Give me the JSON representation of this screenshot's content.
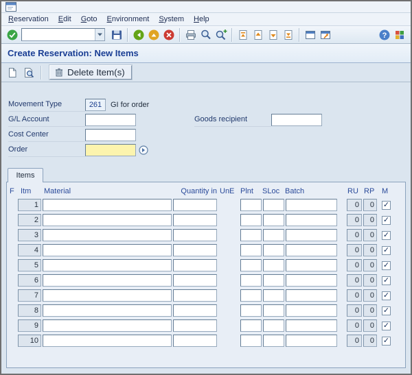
{
  "menu_bar": {
    "items": [
      "Reservation",
      "Edit",
      "Goto",
      "Environment",
      "System",
      "Help"
    ]
  },
  "toolbar": {
    "command_field_value": "",
    "icons": [
      "enter",
      "command-field-dropdown",
      "save",
      "back",
      "exit",
      "cancel",
      "print",
      "find",
      "find-next",
      "first-page",
      "page-up",
      "page-down",
      "last-page",
      "new-session",
      "generate-shortcut",
      "help",
      "customize-layout"
    ]
  },
  "title": "Create Reservation: New Items",
  "app_toolbar": {
    "icons": [
      "new-item",
      "overview",
      "trash"
    ],
    "delete_button_label": "Delete Item(s)"
  },
  "form": {
    "movement_type": {
      "label": "Movement Type",
      "value": "261",
      "description": "GI for order"
    },
    "gl_account": {
      "label": "G/L Account",
      "value": ""
    },
    "goods_recipient": {
      "label": "Goods recipient",
      "value": ""
    },
    "cost_center": {
      "label": "Cost Center",
      "value": ""
    },
    "order": {
      "label": "Order",
      "value": ""
    }
  },
  "items": {
    "tab_label": "Items",
    "columns": [
      "F",
      "Itm",
      "Material",
      "Quantity in",
      "UnE",
      "Plnt",
      "SLoc",
      "Batch",
      "RU",
      "RP",
      "M"
    ],
    "check_glyph": "✓",
    "rows": [
      {
        "itm": "1",
        "material": "",
        "quantity": "",
        "une": "",
        "plnt": "",
        "sloc": "",
        "batch": "",
        "ru": "0",
        "rp": "0",
        "m": true
      },
      {
        "itm": "2",
        "material": "",
        "quantity": "",
        "une": "",
        "plnt": "",
        "sloc": "",
        "batch": "",
        "ru": "0",
        "rp": "0",
        "m": true
      },
      {
        "itm": "3",
        "material": "",
        "quantity": "",
        "une": "",
        "plnt": "",
        "sloc": "",
        "batch": "",
        "ru": "0",
        "rp": "0",
        "m": true
      },
      {
        "itm": "4",
        "material": "",
        "quantity": "",
        "une": "",
        "plnt": "",
        "sloc": "",
        "batch": "",
        "ru": "0",
        "rp": "0",
        "m": true
      },
      {
        "itm": "5",
        "material": "",
        "quantity": "",
        "une": "",
        "plnt": "",
        "sloc": "",
        "batch": "",
        "ru": "0",
        "rp": "0",
        "m": true
      },
      {
        "itm": "6",
        "material": "",
        "quantity": "",
        "une": "",
        "plnt": "",
        "sloc": "",
        "batch": "",
        "ru": "0",
        "rp": "0",
        "m": true
      },
      {
        "itm": "7",
        "material": "",
        "quantity": "",
        "une": "",
        "plnt": "",
        "sloc": "",
        "batch": "",
        "ru": "0",
        "rp": "0",
        "m": true
      },
      {
        "itm": "8",
        "material": "",
        "quantity": "",
        "une": "",
        "plnt": "",
        "sloc": "",
        "batch": "",
        "ru": "0",
        "rp": "0",
        "m": true
      },
      {
        "itm": "9",
        "material": "",
        "quantity": "",
        "une": "",
        "plnt": "",
        "sloc": "",
        "batch": "",
        "ru": "0",
        "rp": "0",
        "m": true
      },
      {
        "itm": "10",
        "material": "",
        "quantity": "",
        "une": "",
        "plnt": "",
        "sloc": "",
        "batch": "",
        "ru": "0",
        "rp": "0",
        "m": true
      }
    ]
  }
}
